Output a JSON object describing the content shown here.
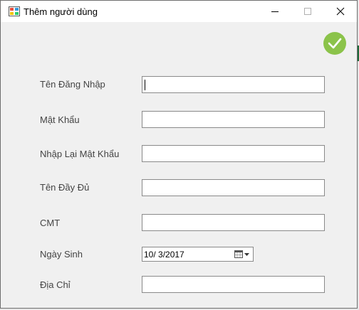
{
  "window": {
    "title": "Thêm người dùng"
  },
  "form": {
    "username_label": "Tên Đăng Nhập",
    "password_label": "Mật Khẩu",
    "confirm_password_label": "Nhập Lại Mật Khẩu",
    "fullname_label": "Tên Đầy Đủ",
    "id_label": "CMT",
    "dob_label": "Ngày Sinh",
    "dob_value": "10/  3/2017",
    "address_label": "Địa Chỉ"
  },
  "icons": {
    "confirm": "check-icon",
    "calendar": "calendar-dropdown-icon"
  },
  "colors": {
    "confirm_button": "#8bc34a"
  }
}
